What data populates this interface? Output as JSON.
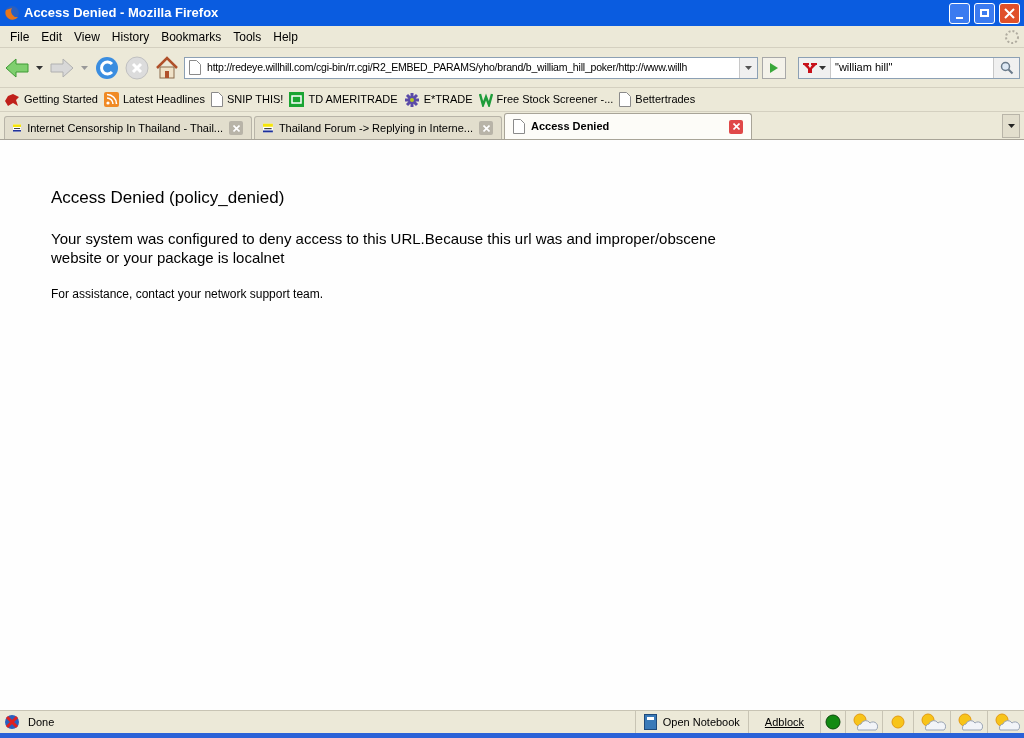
{
  "window": {
    "title": "Access Denied - Mozilla Firefox"
  },
  "menu": [
    "File",
    "Edit",
    "View",
    "History",
    "Bookmarks",
    "Tools",
    "Help"
  ],
  "address_bar": {
    "value": "http://redeye.willhill.com/cgi-bin/rr.cgi/R2_EMBED_PARAMS/yho/brand/b_william_hill_poker/http://www.willh"
  },
  "search": {
    "value": "\"william hill\""
  },
  "bookmarks": [
    {
      "label": "Getting Started",
      "kind": "dino"
    },
    {
      "label": "Latest Headlines",
      "kind": "rss"
    },
    {
      "label": "SNIP THIS!",
      "kind": "page"
    },
    {
      "label": "TD AMERITRADE",
      "kind": "td"
    },
    {
      "label": "E*TRADE",
      "kind": "etrade"
    },
    {
      "label": "Free Stock Screener -...",
      "kind": "w"
    },
    {
      "label": "Bettertrades",
      "kind": "page"
    }
  ],
  "tabs": [
    {
      "label": "Internet Censorship In Thailand - Thail...",
      "kind": "forum",
      "selected": false
    },
    {
      "label": "Thailand Forum -> Replying in Interne...",
      "kind": "forum",
      "selected": false
    },
    {
      "label": "Access Denied",
      "kind": "page",
      "selected": true
    }
  ],
  "page": {
    "heading": "Access Denied (policy_denied)",
    "message": "Your system was configured to deny access to this URL.Because this url was and improper/obscene website or your package is localnet",
    "note": "For assistance, contact your network support team."
  },
  "status_bar": {
    "status": "Done",
    "notebook": "Open Notebook",
    "adblock": "Adblock",
    "weather": [
      {
        "kind": "cloudsun"
      },
      {
        "kind": "sun"
      },
      {
        "kind": "cloudsun"
      },
      {
        "kind": "cloudsun"
      },
      {
        "kind": "cloudsun"
      }
    ]
  }
}
